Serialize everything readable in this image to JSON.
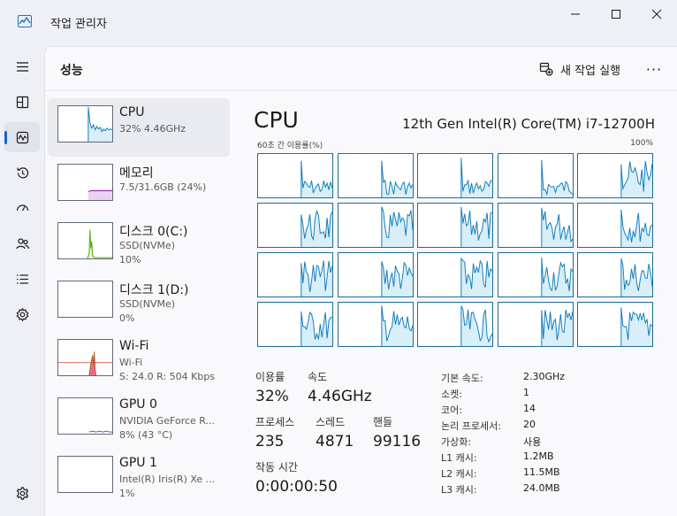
{
  "window": {
    "title": "작업 관리자"
  },
  "header": {
    "title": "성능",
    "new_task_label": "새 작업 실행",
    "more_label": "···"
  },
  "colors": {
    "accent": "#1466c2",
    "cpu_line": "#117dbb",
    "cpu_fill": "#d8eef9",
    "disk_line": "#4da60c",
    "wifi_line": "#a74f01",
    "wifi_fill": "#e86d8a",
    "gpu_line": "#8e44ad"
  },
  "nav": {
    "items": [
      {
        "icon": "menu-icon"
      },
      {
        "icon": "processes-icon"
      },
      {
        "icon": "performance-icon"
      },
      {
        "icon": "app-history-icon"
      },
      {
        "icon": "startup-apps-icon"
      },
      {
        "icon": "users-icon"
      },
      {
        "icon": "details-icon"
      },
      {
        "icon": "services-icon"
      },
      {
        "icon": "settings-icon"
      }
    ]
  },
  "sidebar": {
    "items": [
      {
        "name": "CPU",
        "line1": "32% 4.46GHz",
        "line2": ""
      },
      {
        "name": "메모리",
        "line1": "7.5/31.6GB (24%)",
        "line2": ""
      },
      {
        "name": "디스크 0(C:)",
        "line1": "SSD(NVMe)",
        "line2": "10%"
      },
      {
        "name": "디스크 1(D:)",
        "line1": "SSD(NVMe)",
        "line2": "0%"
      },
      {
        "name": "Wi-Fi",
        "line1": "Wi-Fi",
        "line2": "S: 24.0  R: 504 Kbps"
      },
      {
        "name": "GPU 0",
        "line1": "NVIDIA GeForce R...",
        "line2": "8% (43 °C)"
      },
      {
        "name": "GPU 1",
        "line1": "Intel(R) Iris(R) Xe ...",
        "line2": "1%"
      }
    ]
  },
  "detail": {
    "title": "CPU",
    "model": "12th Gen Intel(R) Core(TM) i7-12700H",
    "graph_label": "60초 간 이용률(%)",
    "graph_max": "100%",
    "logical_processors": 20,
    "stats": {
      "utilization_label": "이용률",
      "utilization_value": "32%",
      "speed_label": "속도",
      "speed_value": "4.46GHz",
      "processes_label": "프로세스",
      "processes_value": "235",
      "threads_label": "스레드",
      "threads_value": "4871",
      "handles_label": "핸들",
      "handles_value": "99116",
      "uptime_label": "작동 시간",
      "uptime_value": "0:00:00:50"
    },
    "specs": [
      {
        "label": "기본 속도:",
        "value": "2.30GHz"
      },
      {
        "label": "소켓:",
        "value": "1"
      },
      {
        "label": "코어:",
        "value": "14"
      },
      {
        "label": "논리 프로세서:",
        "value": "20"
      },
      {
        "label": "가상화:",
        "value": "사용"
      },
      {
        "label": "L1 캐시:",
        "value": "1.2MB"
      },
      {
        "label": "L2 캐시:",
        "value": "11.5MB"
      },
      {
        "label": "L3 캐시:",
        "value": "24.0MB"
      }
    ]
  }
}
